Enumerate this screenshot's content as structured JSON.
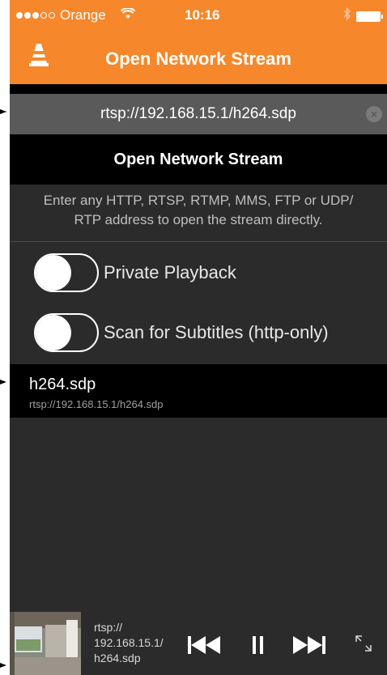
{
  "status_bar": {
    "carrier": "Orange",
    "time": "10:16",
    "signal_icon": "signal-dots-icon",
    "wifi_icon": "wifi-icon",
    "bluetooth_icon": "bluetooth-icon",
    "battery_icon": "battery-icon"
  },
  "nav": {
    "title": "Open Network Stream",
    "logo_icon": "vlc-cone-icon"
  },
  "url_field": {
    "value": "rtsp://192.168.15.1/h264.sdp",
    "clear_icon": "clear-icon"
  },
  "open_button": {
    "label": "Open Network Stream"
  },
  "description": {
    "line1": "Enter any HTTP, RTSP, RTMP, MMS, FTP or UDP/",
    "line2": "RTP address to open the stream directly."
  },
  "toggles": [
    {
      "label": "Private Playback",
      "on": false
    },
    {
      "label": "Scan for Subtitles (http-only)",
      "on": false
    }
  ],
  "recent": [
    {
      "name": "h264.sdp",
      "url": "rtsp://192.168.15.1/h264.sdp"
    }
  ],
  "player": {
    "line1": "rtsp://",
    "line2": "192.168.15.1/",
    "line3": "h264.sdp",
    "controls": [
      "previous-icon",
      "pause-icon",
      "next-icon",
      "fullscreen-icon"
    ]
  },
  "colors": {
    "accent": "#f6872a",
    "background": "#2b2b2b",
    "url_field": "#5a5a5a"
  }
}
